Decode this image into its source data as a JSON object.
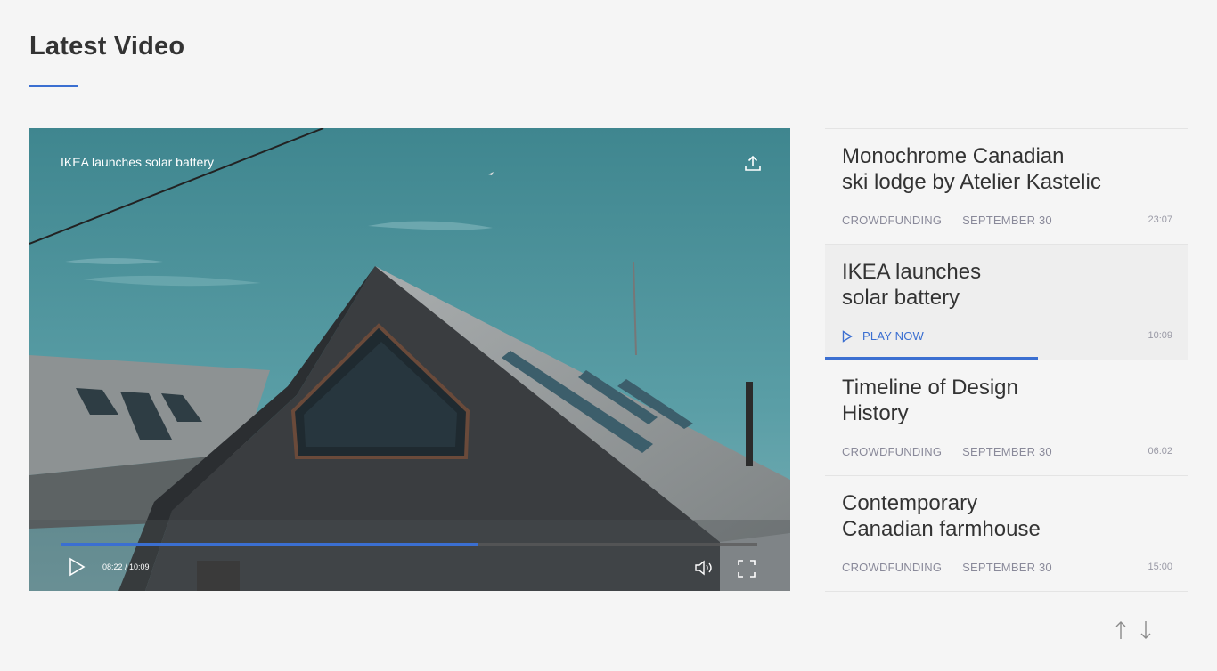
{
  "section": {
    "title": "Latest Video",
    "accent_color": "#3b6fd1"
  },
  "player": {
    "title": "IKEA launches solar battery",
    "time": "08:22 / 10:09",
    "progress_fraction": 0.6,
    "share_icon": "upload-icon",
    "play_icon": "play-icon",
    "volume_icon": "volume-icon",
    "fullscreen_icon": "fullscreen-icon"
  },
  "playlist": {
    "items": [
      {
        "title_line1": "Monochrome Canadian",
        "title_line2": "ski lodge by Atelier Kastelic",
        "category": "CROWDFUNDING",
        "date": "SEPTEMBER 30",
        "duration": "23:07"
      },
      {
        "title_line1": "IKEA launches",
        "title_line2": "solar battery",
        "play_label": "PLAY NOW",
        "duration": "10:09",
        "progress_fraction": 0.585
      },
      {
        "title_line1": "Timeline of Design",
        "title_line2": "History",
        "category": "CROWDFUNDING",
        "date": "SEPTEMBER 30",
        "duration": "06:02"
      },
      {
        "title_line1": "Contemporary",
        "title_line2": "Canadian farmhouse",
        "category": "CROWDFUNDING",
        "date": "SEPTEMBER 30",
        "duration": "15:00"
      }
    ],
    "nav_icons": [
      "arrow-up-icon",
      "arrow-down-icon"
    ]
  }
}
